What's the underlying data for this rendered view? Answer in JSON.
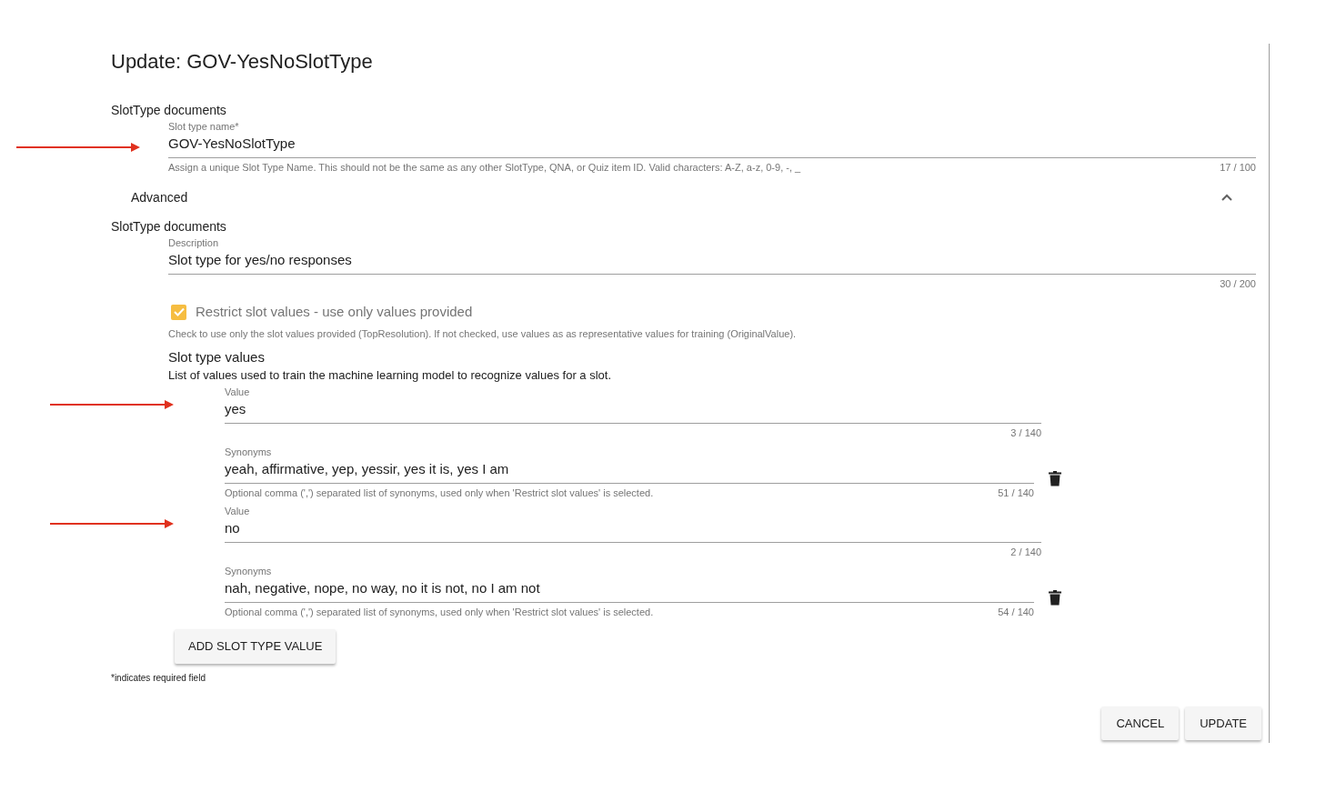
{
  "title": "Update: GOV-YesNoSlotType",
  "section_1": "SlotType documents",
  "name_field": {
    "label": "Slot type name*",
    "value": "GOV-YesNoSlotType",
    "helper": "Assign a unique Slot Type Name. This should not be the same as any other SlotType, QNA, or Quiz item ID. Valid characters: A-Z, a-z, 0-9, -, _",
    "counter": "17 / 100",
    "annotated": true
  },
  "advanced": {
    "label": "Advanced",
    "expanded": true
  },
  "section_2": "SlotType documents",
  "description_field": {
    "label": "Description",
    "value": "Slot type for yes/no responses",
    "counter": "30 / 200"
  },
  "restrict": {
    "label": "Restrict slot values - use only values provided",
    "checked": true,
    "helper": "Check to use only the slot values provided (TopResolution). If not checked, use values as as representative values for training (OriginalValue)."
  },
  "slot_values": {
    "heading": "Slot type values",
    "description": "List of values used to train the machine learning model to recognize values for a slot.",
    "items": [
      {
        "value_label": "Value",
        "value": "yes",
        "value_counter": "3 / 140",
        "synonyms_label": "Synonyms",
        "synonyms": "yeah, affirmative, yep, yessir, yes it is, yes I am",
        "synonyms_helper": "Optional comma (',') separated list of synonyms, used only when 'Restrict slot values' is selected.",
        "synonyms_counter": "51 / 140",
        "annotated": true
      },
      {
        "value_label": "Value",
        "value": "no",
        "value_counter": "2 / 140",
        "synonyms_label": "Synonyms",
        "synonyms": "nah, negative, nope, no way, no it is not, no I am not",
        "synonyms_helper": "Optional comma (',') separated list of synonyms, used only when 'Restrict slot values' is selected.",
        "synonyms_counter": "54 / 140",
        "annotated": true
      }
    ]
  },
  "add_button": "ADD SLOT TYPE VALUE",
  "required_note": "*indicates required field",
  "buttons": [
    "CANCEL",
    "UPDATE"
  ]
}
